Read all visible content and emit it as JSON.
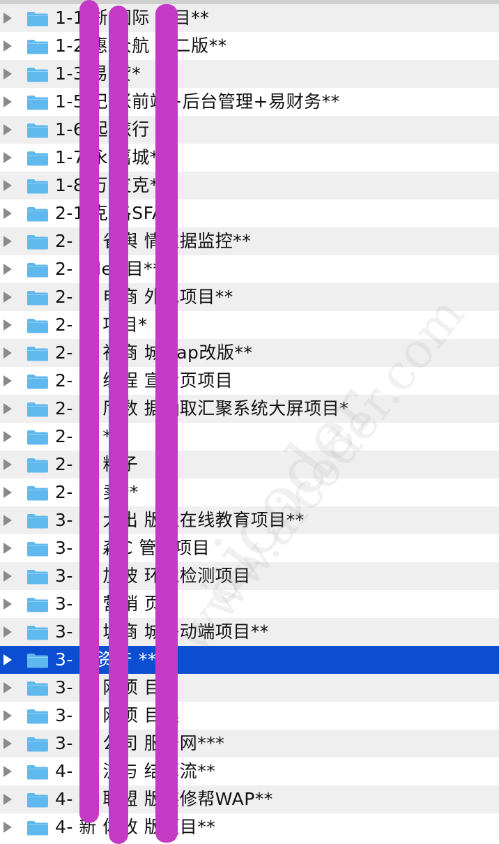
{
  "rows": [
    {
      "name": "1-1  浙  国际  项目**",
      "selected": false
    },
    {
      "name": "1-2  惠  众航  第二版**",
      "selected": false
    },
    {
      "name": "1-3  易  贷*",
      "selected": false
    },
    {
      "name": "1-5  记  账前端+后台管理+易财务**",
      "selected": false
    },
    {
      "name": "1-6  起  旅行",
      "selected": false
    },
    {
      "name": "1-7  永  嘉城*",
      "selected": false
    },
    {
      "name": "1-8  万  支克*",
      "selected": false
    },
    {
      "name": "2-1  克  洛SFA",
      "selected": false
    },
    {
      "name": "2-  施  省舆  情数据监控**",
      "selected": false
    },
    {
      "name": "2-  oder  目**",
      "selected": false
    },
    {
      "name": "2-  中  电商  外包项目**",
      "selected": false
    },
    {
      "name": "2-  办  项目*",
      "selected": false
    },
    {
      "name": "2-  新  社商  城wap改版**",
      "selected": false
    },
    {
      "name": "2-  少  编程  宣传页项目",
      "selected": false
    },
    {
      "name": "2-  政  厅数  据抽取汇聚系统大屏项目*",
      "selected": false
    },
    {
      "name": "2-  惠  *",
      "selected": false
    },
    {
      "name": "2-  小  籽子",
      "selected": false
    },
    {
      "name": "2-  外  卖**",
      "selected": false
    },
    {
      "name": "3-  复  大出  版社在线教育项目**",
      "selected": false
    },
    {
      "name": "3-  汉  森C  管理项目",
      "selected": false
    },
    {
      "name": "3-  新  加坡  环境检测项目",
      "selected": false
    },
    {
      "name": "3-  数  营销  页",
      "selected": false
    },
    {
      "name": "3-  商  城商  城移动端项目**",
      "selected": false
    },
    {
      "name": "3-  X  资产  **",
      "selected": true
    },
    {
      "name": "3-  后  网项  目",
      "selected": false
    },
    {
      "name": "3-  边  网项  目集",
      "selected": false
    },
    {
      "name": "3-  证  公司  服务网***",
      "selected": false
    },
    {
      "name": "4-  物  流与  结算流**",
      "selected": false
    },
    {
      "name": "4-  商  联盟  版装修帮WAP**",
      "selected": false
    },
    {
      "name": "4-  新  体改  版项目**",
      "selected": false
    }
  ],
  "watermark": {
    "primary": "aicoder",
    "secondary": "www.aicoder.com"
  },
  "colors": {
    "row_alt": "#efefef",
    "row_base": "#ffffff",
    "selection": "#0b4ed1",
    "folder": "#5fb8ee",
    "redaction": "#c43ac5"
  },
  "icons": {
    "row_icon": "folder-icon",
    "expand_icon": "disclosure-triangle-icon"
  }
}
